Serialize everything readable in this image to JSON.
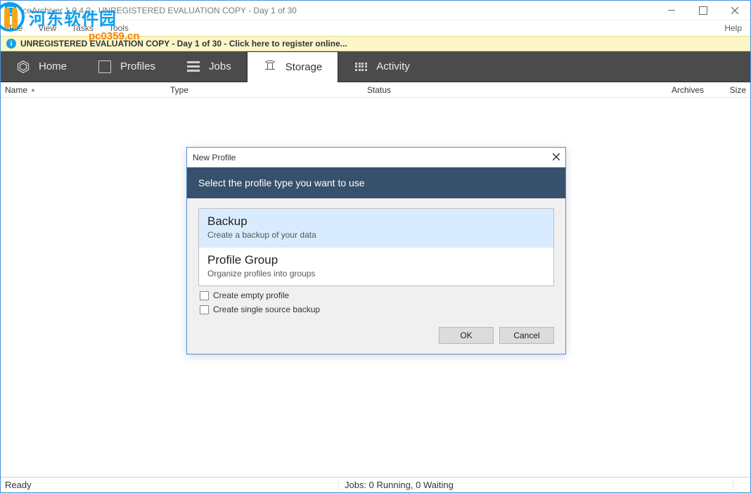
{
  "titlebar": {
    "title": "IceArchiver 1.0.4.2 - UNREGISTERED EVALUATION COPY - Day 1 of 30"
  },
  "menubar": {
    "items": [
      "File",
      "View",
      "Tasks",
      "Tools"
    ],
    "right": "Help"
  },
  "banner": {
    "strong": "UNREGISTERED EVALUATION COPY - Day 1 of 30 - Click here to register online..."
  },
  "nav": {
    "tabs": [
      {
        "label": "Home",
        "active": false
      },
      {
        "label": "Profiles",
        "active": false
      },
      {
        "label": "Jobs",
        "active": false
      },
      {
        "label": "Storage",
        "active": true
      },
      {
        "label": "Activity",
        "active": false
      }
    ]
  },
  "columns": {
    "name": "Name",
    "type": "Type",
    "status": "Status",
    "archives": "Archives",
    "size": "Size",
    "sort_indicator": "▲"
  },
  "dialog": {
    "title": "New Profile",
    "banner": "Select the profile type you want to use",
    "types": [
      {
        "title": "Backup",
        "desc": "Create a backup of your data",
        "selected": true
      },
      {
        "title": "Profile Group",
        "desc": "Organize profiles into groups",
        "selected": false
      }
    ],
    "checkboxes": [
      {
        "label": "Create empty profile",
        "checked": false
      },
      {
        "label": "Create single source backup",
        "checked": false
      }
    ],
    "buttons": {
      "ok": "OK",
      "cancel": "Cancel"
    }
  },
  "statusbar": {
    "left": "Ready",
    "center": "Jobs: 0 Running, 0 Waiting"
  },
  "watermark": {
    "text": "河东软件园",
    "url": "pc0359.cn"
  }
}
